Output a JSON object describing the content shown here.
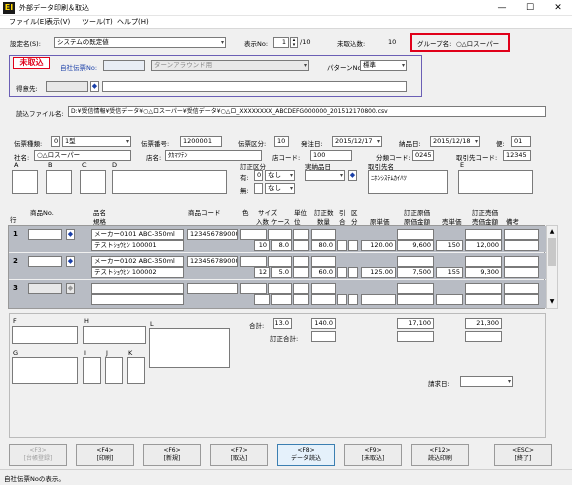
{
  "window": {
    "title": "外部データ印刷＆取込",
    "icon_text": "EI"
  },
  "menu": [
    "ファイル(E)",
    "表示(V)",
    "ツール(T)",
    "ヘルプ(H)"
  ],
  "top": {
    "setting_label": "設定名(S):",
    "setting_value": "システムの既定値",
    "display_no_label": "表示No:",
    "display_no_value": "1",
    "display_no_total": "/10",
    "unimported_label": "未取込数:",
    "unimported_value": "10",
    "group_label": "グループ名:",
    "group_value": "○△ロスーパー"
  },
  "header_panel": {
    "status_badge": "未取込",
    "own_slip_label": "自社伝票No:",
    "own_slip_value": "",
    "turnaround_value": "ターンアラウンド用",
    "pattern_label": "パターンNo:",
    "pattern_value": "標準",
    "customer_label": "得意先:"
  },
  "file": {
    "label": "読込ファイル名:",
    "path": "D:¥受信情報¥受信データ¥○△ロスーパー¥受信データ¥○△ロ_XXXXXXXX_ABCDEFG000000_201512170800.csv"
  },
  "slip": {
    "type_label": "伝票種類:",
    "type_code": "0",
    "type_value": "1型",
    "slip_no_label": "伝票番号:",
    "slip_no_value": "1200001",
    "slip_div_label": "伝票区分:",
    "slip_div_value": "10",
    "order_date_label": "発注日:",
    "order_date_value": "2015/12/17",
    "delivery_date_label": "納品日:",
    "delivery_date_value": "2015/12/18",
    "bin_label": "便:",
    "bin_value": "01",
    "company_label": "社名:",
    "company_value": "○△ロスーパー",
    "store_name_label": "店名:",
    "store_name_value": "ﾀｶﾏﾂﾃﾝ",
    "store_code_label": "店コード:",
    "store_code_value": "100",
    "class_code_label": "分類コード:",
    "class_code_value": "0245",
    "trade_code_label": "取引先コード:",
    "trade_code_value": "12345",
    "a_label": "A",
    "b_label": "B",
    "c_label": "C",
    "d_label": "D",
    "correction_label": "訂正区分",
    "yes_label": "有:",
    "yes_code": "0",
    "yes_value": "なし",
    "no_label": "無:",
    "no_value": "なし",
    "actual_date_label": "実納品日",
    "supplier_label": "取引先名",
    "supplier_value": "ﾆﾎﾝｼｽﾃﾑｶｲﾊﾂ",
    "e_label": "E"
  },
  "columns": {
    "row": "行",
    "item_no": "商品No.",
    "name": "品名",
    "spec": "規格",
    "product_code": "商品コード",
    "color": "色",
    "size": "サイズ",
    "per_case": "入数",
    "case": "ケース",
    "unit": "単位",
    "unit2": "位",
    "corr_qty": "訂正数",
    "qty": "数量",
    "pull": "引",
    "pull2": "合",
    "div": "区",
    "div2": "分",
    "cost_price": "原単価",
    "corr_cost": "訂正原価",
    "cost_amount": "原価金額",
    "sell_price": "売単価",
    "corr_sell": "訂正売価",
    "sell_amount": "売価金額",
    "remarks": "備考"
  },
  "rows": [
    {
      "num": "1",
      "name": "メーカー0101 ABC-350ml",
      "spec": "テストｼｮｳﾋﾝ 100001",
      "code": "1234567890001",
      "per_case": "10",
      "case_qty": "8.0",
      "qty": "80.0",
      "cost": "120.00",
      "cost_amount": "9,600",
      "sell": "150",
      "sell_amount": "12,000"
    },
    {
      "num": "2",
      "name": "メーカー0102 ABC-350ml",
      "spec": "テストｼｮｳﾋﾝ 100002",
      "code": "1234567890002",
      "per_case": "12",
      "case_qty": "5.0",
      "qty": "60.0",
      "cost": "125.00",
      "cost_amount": "7,500",
      "sell": "155",
      "sell_amount": "9,300"
    },
    {
      "num": "3",
      "name": "",
      "spec": "",
      "code": "",
      "per_case": "",
      "case_qty": "",
      "qty": "",
      "cost": "",
      "cost_amount": "",
      "sell": "",
      "sell_amount": ""
    }
  ],
  "footer": {
    "f_label": "F",
    "h_label": "H",
    "l_label": "L",
    "g_label": "G",
    "i_label": "I",
    "j_label": "J",
    "k_label": "K",
    "total_label": "合計:",
    "total_case": "13.0",
    "total_qty": "140.0",
    "total_cost": "17,100",
    "total_sell": "21,300",
    "corr_total_label": "訂正合計:",
    "invoice_date_label": "請求日:"
  },
  "fkeys": [
    {
      "key": "<F3>",
      "label": "[台帳登録]",
      "state": "dis"
    },
    {
      "key": "<F4>",
      "label": "[印刷]",
      "state": ""
    },
    {
      "key": "<F6>",
      "label": "[新規]",
      "state": ""
    },
    {
      "key": "<F7>",
      "label": "[取込]",
      "state": ""
    },
    {
      "key": "<F8>",
      "label": "データ読込",
      "state": "sel"
    },
    {
      "key": "<F9>",
      "label": "[未取込]",
      "state": ""
    },
    {
      "key": "<F12>",
      "label": "読込印刷",
      "state": ""
    },
    {
      "key": "<ESC>",
      "label": "[終了]",
      "state": ""
    }
  ],
  "status": "自社伝票Noの表示。",
  "colors": {
    "highlight_border": "#e0001a",
    "badge_text": "#e0001a",
    "panel_border": "#6b5fb5",
    "row_header": "#b8bcc4",
    "link_blue": "#1a3fa8"
  }
}
